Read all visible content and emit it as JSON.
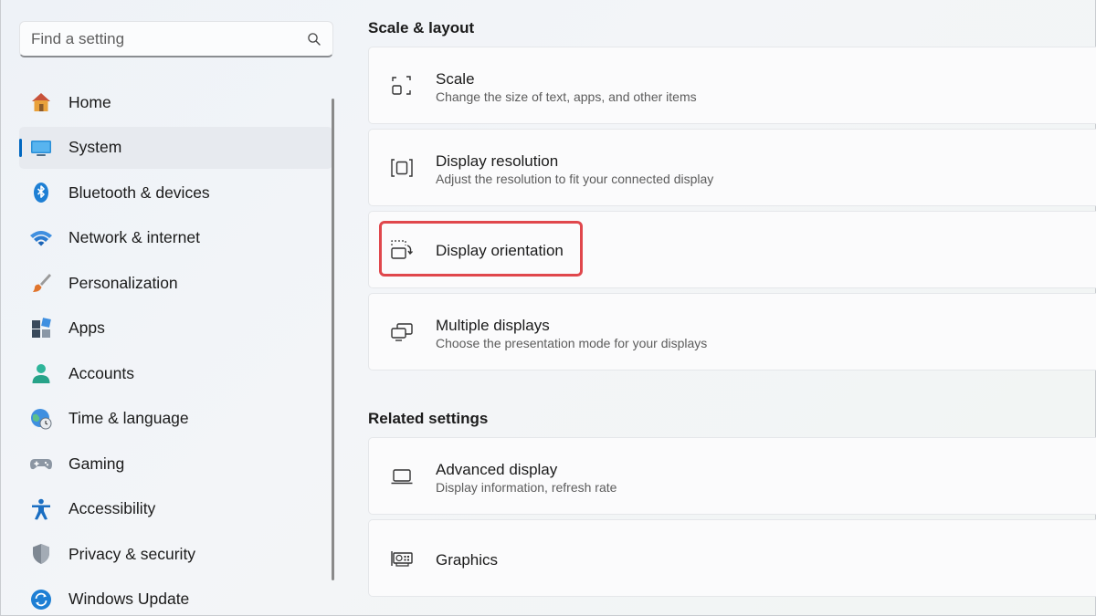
{
  "search": {
    "placeholder": "Find a setting",
    "icon": "search-icon"
  },
  "sidebar": {
    "items": [
      {
        "label": "Home",
        "icon": "home-icon"
      },
      {
        "label": "System",
        "icon": "monitor-icon",
        "selected": true
      },
      {
        "label": "Bluetooth & devices",
        "icon": "bluetooth-icon"
      },
      {
        "label": "Network & internet",
        "icon": "wifi-icon"
      },
      {
        "label": "Personalization",
        "icon": "brush-icon"
      },
      {
        "label": "Apps",
        "icon": "apps-icon"
      },
      {
        "label": "Accounts",
        "icon": "person-icon"
      },
      {
        "label": "Time & language",
        "icon": "globe-clock-icon"
      },
      {
        "label": "Gaming",
        "icon": "gamepad-icon"
      },
      {
        "label": "Accessibility",
        "icon": "accessibility-icon"
      },
      {
        "label": "Privacy & security",
        "icon": "shield-icon"
      },
      {
        "label": "Windows Update",
        "icon": "update-icon"
      }
    ]
  },
  "main": {
    "scale_layout": {
      "title": "Scale & layout",
      "cards": [
        {
          "title": "Scale",
          "subtitle": "Change the size of text, apps, and other items",
          "icon": "scale-icon"
        },
        {
          "title": "Display resolution",
          "subtitle": "Adjust the resolution to fit your connected display",
          "icon": "resolution-icon"
        },
        {
          "title": "Display orientation",
          "subtitle": "",
          "icon": "orientation-icon",
          "highlighted": true
        },
        {
          "title": "Multiple displays",
          "subtitle": "Choose the presentation mode for your displays",
          "icon": "multiple-displays-icon"
        }
      ]
    },
    "related": {
      "title": "Related settings",
      "cards": [
        {
          "title": "Advanced display",
          "subtitle": "Display information, refresh rate",
          "icon": "laptop-icon"
        },
        {
          "title": "Graphics",
          "subtitle": "",
          "icon": "graphics-card-icon"
        }
      ]
    }
  },
  "colors": {
    "accent": "#0067c0",
    "highlight": "#e0474c"
  }
}
